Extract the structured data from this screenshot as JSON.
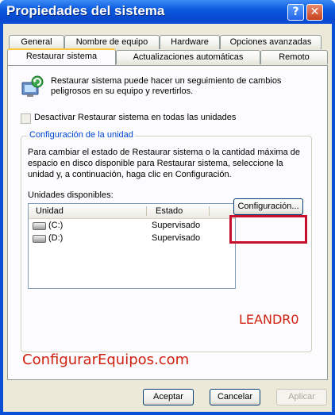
{
  "window": {
    "title": "Propiedades del sistema"
  },
  "titlebar": {
    "help_glyph": "?",
    "close_glyph": "✕"
  },
  "tabs_row1": [
    "General",
    "Nombre de equipo",
    "Hardware",
    "Opciones avanzadas"
  ],
  "tabs_row2": [
    "Restaurar sistema",
    "Actualizaciones automáticas",
    "Remoto"
  ],
  "active_tab": "Restaurar sistema",
  "panel": {
    "info_text": "Restaurar sistema puede hacer un seguimiento de cambios peligrosos en su equipo y revertirlos.",
    "disable_checkbox_label": "Desactivar Restaurar sistema en todas las unidades",
    "disable_checked": false,
    "group_label": "Configuración de la unidad",
    "group_text": "Para cambiar el estado de Restaurar sistema o la cantidad máxima de espacio en disco disponible para Restaurar sistema, seleccione la unidad y, a continuación, haga clic en Configuración.",
    "available_label": "Unidades disponibles:",
    "columns": [
      "Unidad",
      "Estado"
    ],
    "drives": [
      {
        "name": "(C:)",
        "state": "Supervisado"
      },
      {
        "name": "(D:)",
        "state": "Supervisado"
      }
    ],
    "config_button": "Configuración..."
  },
  "watermarks": {
    "author": "LEANDR0",
    "site": "ConfigurarEquipos.com"
  },
  "footer": {
    "accept": "Aceptar",
    "cancel": "Cancelar",
    "apply": "Aplicar"
  },
  "colors": {
    "titlebar": "#0a5be0",
    "highlight_box": "#c8102e",
    "watermark": "#d02010",
    "group_label": "#0046d5"
  }
}
